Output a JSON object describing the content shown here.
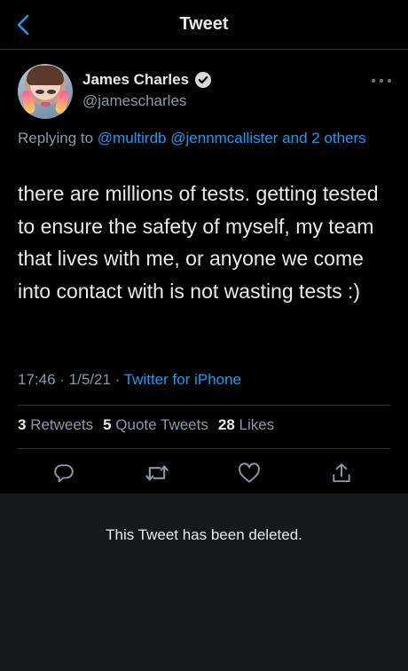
{
  "header": {
    "title": "Tweet"
  },
  "tweet": {
    "author_name": "James Charles",
    "handle": "@jamescharles",
    "replying_prefix": "Replying to ",
    "mention_1": "@multirdb",
    "mention_2": "@jennmcallister",
    "mention_suffix": "and 2 others",
    "text": "there are millions of tests. getting tested to ensure the safety of myself, my team that lives with me, or anyone we come into contact with is not wasting tests :)",
    "time": "17:46",
    "date": "1/5/21",
    "separator": " · ",
    "source": "Twitter for iPhone"
  },
  "stats": {
    "retweets_count": "3",
    "retweets_label": "Retweets",
    "quotes_count": "5",
    "quotes_label": "Quote Tweets",
    "likes_count": "28",
    "likes_label": "Likes"
  },
  "deleted": {
    "message": "This Tweet has been deleted."
  },
  "colors": {
    "accent": "#1d9bf0",
    "background": "#000000",
    "deleted_bg": "#16181c"
  },
  "icons": [
    "back-icon",
    "verified-icon",
    "more-icon",
    "reply-icon",
    "retweet-icon",
    "like-icon",
    "share-icon"
  ]
}
